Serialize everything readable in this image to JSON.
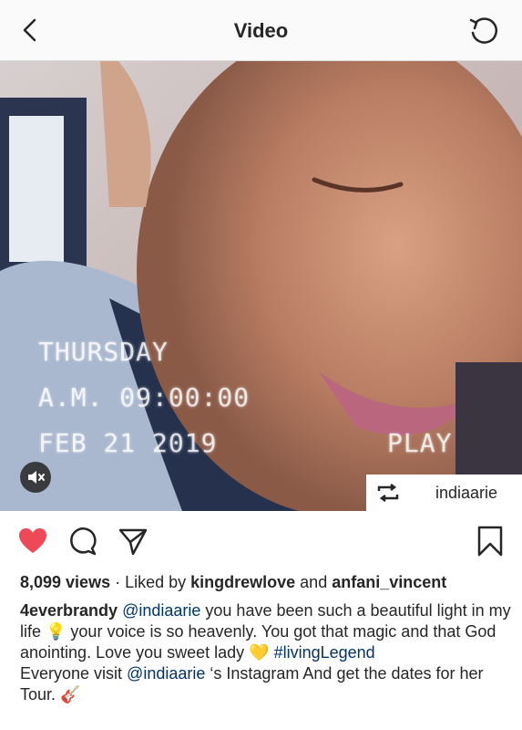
{
  "header": {
    "title": "Video"
  },
  "video": {
    "overlay_day": "THURSDAY",
    "overlay_time": "A.M. 09:00:00",
    "overlay_date": "FEB 21 2019",
    "overlay_play": "PLAY",
    "repost_user": "indiaarie"
  },
  "stats": {
    "views": "8,099 views",
    "liked_by_prefix": " · Liked by ",
    "liker1": "kingdrewlove",
    "and": " and ",
    "liker2": "anfani_vincent"
  },
  "caption": {
    "author": "4everbrandy",
    "mention1": "@indiaarie",
    "text1": " you have been such a beautiful light in my life 💡 your voice is so heavenly. You got that magic and that God anointing. Love you sweet lady 💛",
    "hashtag": "#livingLegend",
    "text2": "Everyone visit ",
    "mention2": "@indiaarie",
    "text3": " ‘s Instagram And get the dates for her Tour. 🎸"
  },
  "colors": {
    "like": "#ed4956",
    "link": "#003569"
  }
}
